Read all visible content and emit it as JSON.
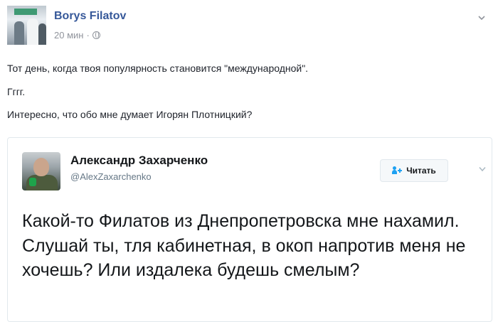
{
  "post": {
    "author": "Borys Filatov",
    "time": "20 мин",
    "separator": "·",
    "icons": {
      "privacy": "globe-icon",
      "menu": "chevron-down-icon"
    },
    "lines": [
      "Тот день, когда твоя популярность становится \"международной\".",
      "Гггг.",
      "Интересно, что обо мне думает Игорян Плотницкий?"
    ]
  },
  "tweet": {
    "name": "Александр Захарченко",
    "handle": "@AlexZaxarchenko",
    "follow_label": "Читать",
    "text": "Какой-то Филатов из Днепропетровска мне нахамил. Слушай ты, тля кабинетная, в окоп напротив меня не хочешь? Или издалека будешь смелым?",
    "icons": {
      "follow": "follow-user-icon",
      "menu": "chevron-down-icon"
    },
    "colors": {
      "follow_icon": "#1da1f2"
    }
  },
  "colors": {
    "author_link": "#365899",
    "meta": "#90949c"
  }
}
